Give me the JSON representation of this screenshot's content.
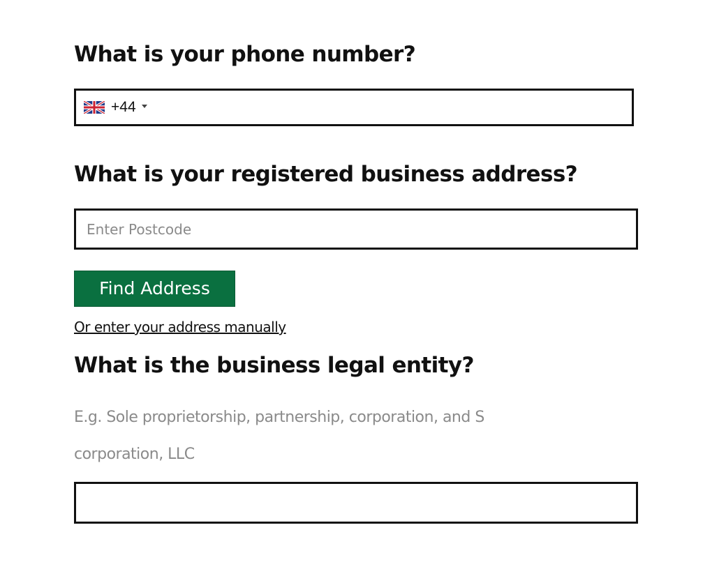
{
  "phone_section": {
    "heading": "What is your phone number?",
    "country_flag": "uk-flag-icon",
    "dial_code": "+44",
    "value": ""
  },
  "address_section": {
    "heading": "What is your registered business address?",
    "postcode_placeholder": "Enter Postcode",
    "find_button_label": "Find Address",
    "manual_link": "Or enter your address manually"
  },
  "entity_section": {
    "heading": "What is the business legal entity?",
    "hint": "E.g. Sole proprietorship, partnership, corporation, and S corporation, LLC",
    "value": ""
  },
  "colors": {
    "button_green": "#0a7040",
    "text": "#111111",
    "placeholder": "#8a8a8a"
  }
}
